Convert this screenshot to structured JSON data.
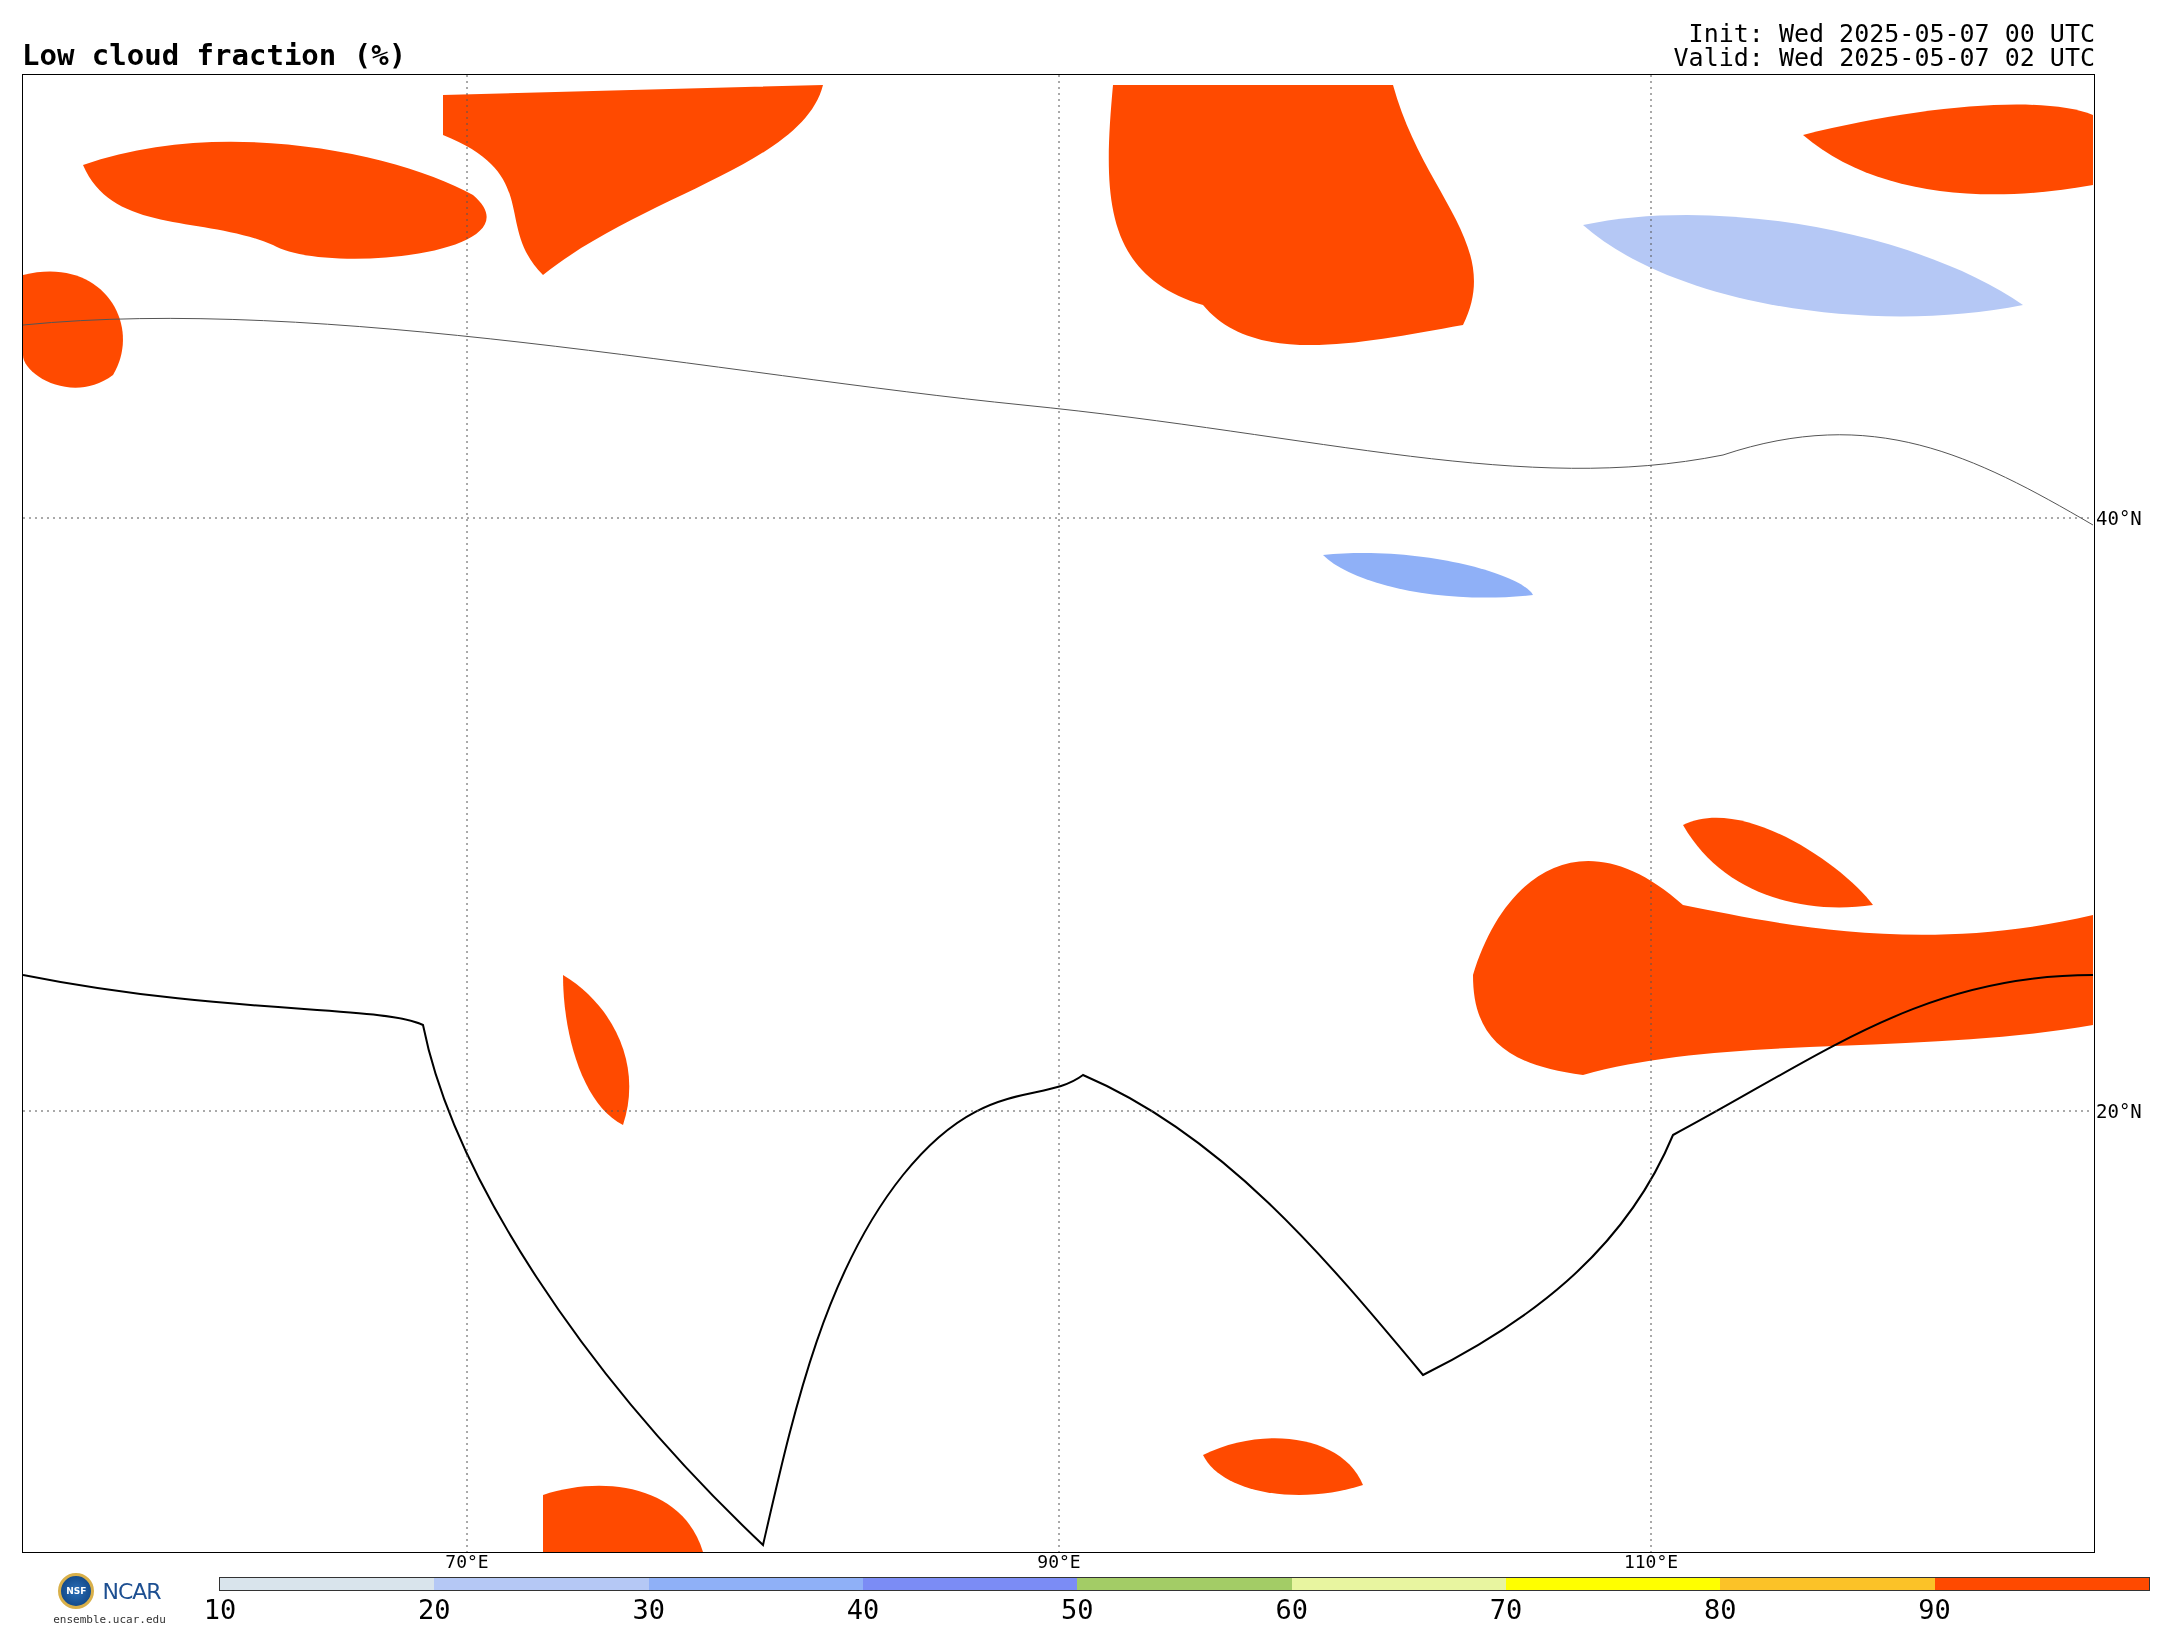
{
  "title": "Low cloud fraction (%)",
  "times": [
    "Init: Wed 2025-05-07 00 UTC",
    "Valid: Wed 2025-05-07 02 UTC"
  ],
  "map": {
    "lat_labels": [
      "40°N",
      "20°N"
    ],
    "lon_labels": [
      "70°E",
      "90°E",
      "110°E"
    ]
  },
  "logos": {
    "nsf": "NSF",
    "ncar": "NCAR",
    "site": "ensemble.ucar.edu"
  },
  "colorbar": {
    "ticks": [
      "10",
      "20",
      "30",
      "40",
      "50",
      "60",
      "70",
      "80",
      "90"
    ],
    "bins": [
      {
        "color": "#d9e4ec"
      },
      {
        "color": "#b5c8f5"
      },
      {
        "color": "#8fb0f7"
      },
      {
        "color": "#7b8cf5"
      },
      {
        "color": "#a3cc66"
      },
      {
        "color": "#e8f5a0"
      },
      {
        "color": "#ffff00"
      },
      {
        "color": "#fbc228"
      },
      {
        "color": "#ff4a00"
      }
    ]
  }
}
